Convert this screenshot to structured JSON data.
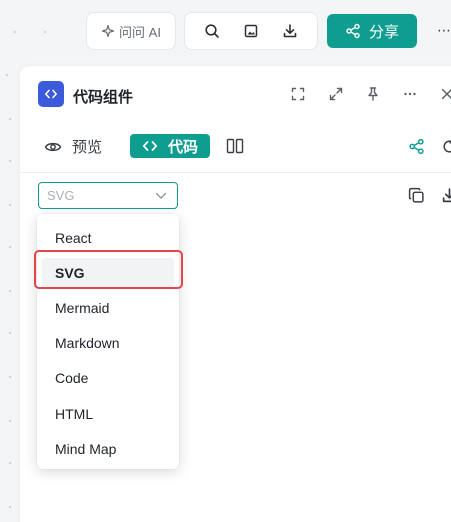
{
  "toolbar": {
    "ask_ai_label": "问问 AI",
    "share_label": "分享"
  },
  "panel": {
    "title": "代码组件",
    "tabs": {
      "preview_label": "预览",
      "code_label": "代码"
    }
  },
  "language_select": {
    "value": "SVG",
    "options": [
      "React",
      "SVG",
      "Mermaid",
      "Markdown",
      "Code",
      "HTML",
      "Mind Map"
    ],
    "selected_index": 1
  },
  "colors": {
    "accent": "#0f9d8f",
    "panel_icon": "#3b5bdb",
    "highlight": "#e2454b"
  },
  "icons": [
    "sparkle-icon",
    "search-icon",
    "image-icon",
    "download-icon",
    "share-icon",
    "more-icon",
    "code-icon",
    "fullscreen-icon",
    "expand-icon",
    "pin-icon",
    "close-icon",
    "eye-icon",
    "split-view-icon",
    "refresh-icon",
    "chevron-down-icon",
    "copy-icon"
  ]
}
